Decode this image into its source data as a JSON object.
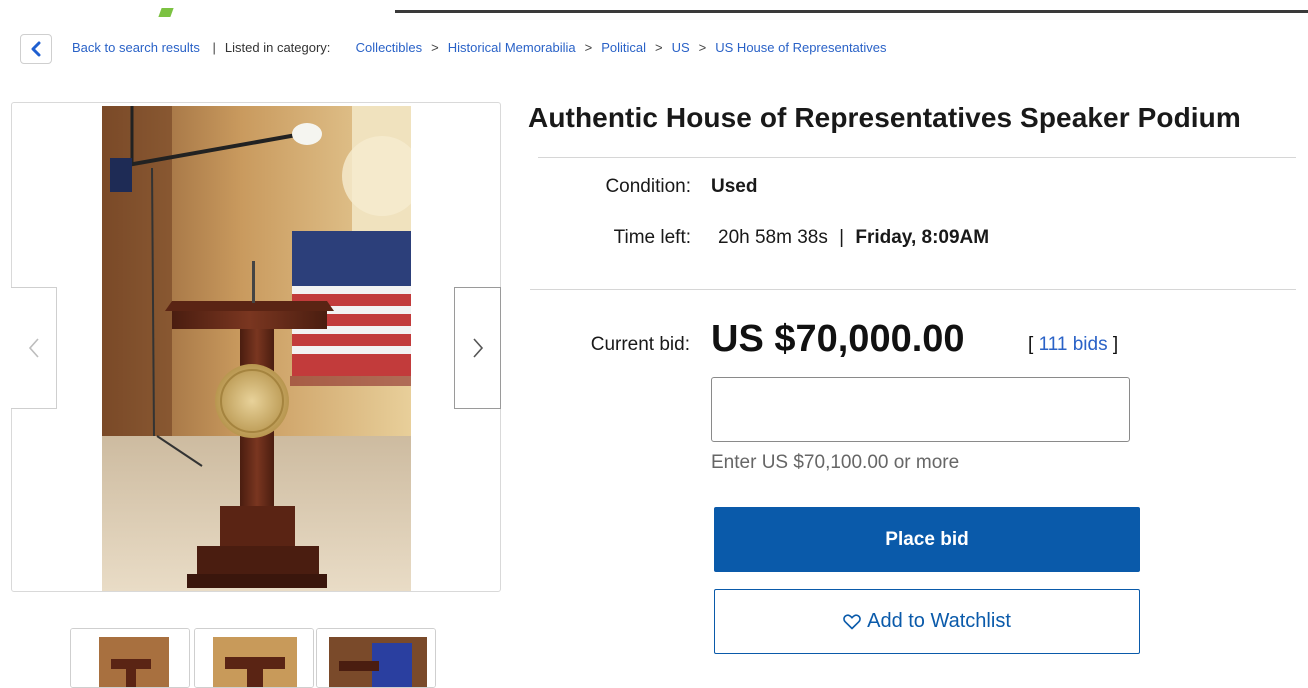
{
  "breadcrumb": {
    "back_label": "Back to search results",
    "listed_label": "Listed in category:",
    "categories": [
      "Collectibles",
      "Historical Memorabilia",
      "Political",
      "US",
      "US House of Representatives"
    ]
  },
  "listing": {
    "title": "Authentic House of Representatives Speaker Podium",
    "condition_label": "Condition:",
    "condition_value": "Used",
    "time_left_label": "Time left:",
    "time_left_value": "20h 58m 38s",
    "end_time": "Friday, 8:09AM",
    "current_bid_label": "Current bid:",
    "current_bid_value": "US $70,000.00",
    "bids_link": "111 bids",
    "bid_input_value": "",
    "bid_hint": "Enter US $70,100.00 or more",
    "place_bid_label": "Place bid",
    "watchlist_label": "Add to Watchlist"
  },
  "icons": {
    "back": "chevron-left-icon",
    "prev": "chevron-left-icon",
    "next": "chevron-right-icon",
    "watch": "heart-outline-icon"
  },
  "colors": {
    "link": "#2a62c7",
    "primary_button": "#0a5aaa"
  }
}
